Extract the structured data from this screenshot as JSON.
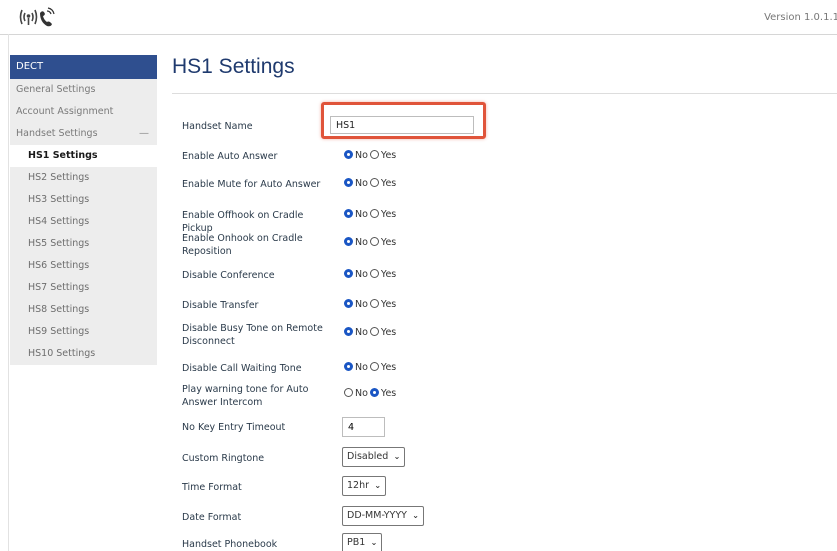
{
  "header": {
    "version": "Version 1.0.1.1",
    "logo_icon": "dect-signal-icon"
  },
  "sidebar": {
    "section": "DECT",
    "items": [
      {
        "label": "General Settings",
        "level": 0
      },
      {
        "label": "Account Assignment",
        "level": 0
      },
      {
        "label": "Handset Settings",
        "level": 0,
        "collapse": "—"
      },
      {
        "label": "HS1 Settings",
        "level": 1,
        "active": true
      },
      {
        "label": "HS2 Settings",
        "level": 1
      },
      {
        "label": "HS3 Settings",
        "level": 1
      },
      {
        "label": "HS4 Settings",
        "level": 1
      },
      {
        "label": "HS5 Settings",
        "level": 1
      },
      {
        "label": "HS6 Settings",
        "level": 1
      },
      {
        "label": "HS7 Settings",
        "level": 1
      },
      {
        "label": "HS8 Settings",
        "level": 1
      },
      {
        "label": "HS9 Settings",
        "level": 1
      },
      {
        "label": "HS10 Settings",
        "level": 1
      }
    ]
  },
  "main": {
    "title": "HS1 Settings",
    "handset_name": {
      "label": "Handset Name",
      "value": "HS1"
    },
    "radio_options": {
      "no": "No",
      "yes": "Yes"
    },
    "radios": [
      {
        "label": "Enable Auto Answer",
        "selected": "No"
      },
      {
        "label": "Enable Mute for Auto Answer",
        "selected": "No"
      },
      {
        "label": "Enable Offhook on Cradle Pickup",
        "selected": "No"
      },
      {
        "label": "Enable Onhook on Cradle Reposition",
        "selected": "No"
      },
      {
        "label": "Disable Conference",
        "selected": "No"
      },
      {
        "label": "Disable Transfer",
        "selected": "No"
      },
      {
        "label": "Disable Busy Tone on Remote Disconnect",
        "selected": "No"
      },
      {
        "label": "Disable Call Waiting Tone",
        "selected": "No"
      },
      {
        "label": "Play warning tone for Auto Answer Intercom",
        "selected": "Yes"
      }
    ],
    "no_key_timeout": {
      "label": "No Key Entry Timeout",
      "value": "4"
    },
    "selects": [
      {
        "label": "Custom Ringtone",
        "value": "Disabled"
      },
      {
        "label": "Time Format",
        "value": "12hr"
      },
      {
        "label": "Date Format",
        "value": "DD-MM-YYYY"
      },
      {
        "label": "Handset Phonebook",
        "value": "PB1"
      }
    ]
  },
  "colors": {
    "accent": "#2f4f8f",
    "highlight": "#e0543a",
    "radio": "#1a56c4"
  }
}
